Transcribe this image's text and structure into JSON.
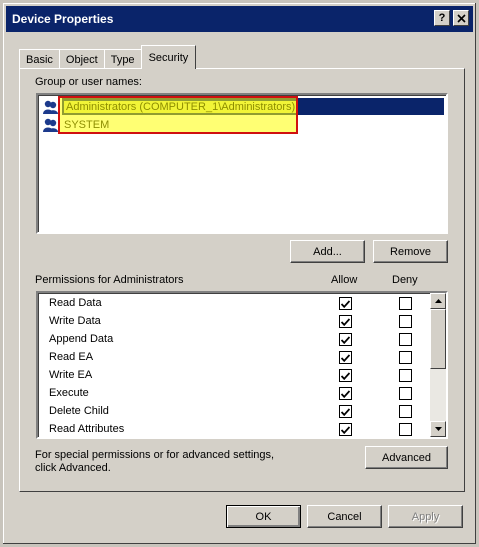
{
  "window": {
    "title": "Device Properties",
    "help_label": "?",
    "close_label": "✕"
  },
  "tabs": [
    {
      "label": "Basic"
    },
    {
      "label": "Object"
    },
    {
      "label": "Type"
    },
    {
      "label": "Security",
      "active": true
    }
  ],
  "security": {
    "group_label": "Group or user names:",
    "users": [
      {
        "name": "Administrators (COMPUTER_1\\Administrators)",
        "selected": true
      },
      {
        "name": "SYSTEM",
        "selected": false
      }
    ],
    "add_label": "Add...",
    "remove_label": "Remove",
    "permissions_label": "Permissions for Administrators",
    "allow_label": "Allow",
    "deny_label": "Deny",
    "permissions": [
      {
        "name": "Read Data",
        "allow": true,
        "deny": false
      },
      {
        "name": "Write Data",
        "allow": true,
        "deny": false
      },
      {
        "name": "Append Data",
        "allow": true,
        "deny": false
      },
      {
        "name": "Read EA",
        "allow": true,
        "deny": false
      },
      {
        "name": "Write EA",
        "allow": true,
        "deny": false
      },
      {
        "name": "Execute",
        "allow": true,
        "deny": false
      },
      {
        "name": "Delete Child",
        "allow": true,
        "deny": false
      },
      {
        "name": "Read Attributes",
        "allow": true,
        "deny": false
      }
    ],
    "advanced_note": "For special permissions or for advanced settings, click Advanced.",
    "advanced_label": "Advanced"
  },
  "footer": {
    "ok_label": "OK",
    "cancel_label": "Cancel",
    "apply_label": "Apply"
  },
  "colors": {
    "titlebar": "#0a246a",
    "selection": "#0a246a",
    "highlight": "#ffff00",
    "highlight_border": "#d01010"
  }
}
